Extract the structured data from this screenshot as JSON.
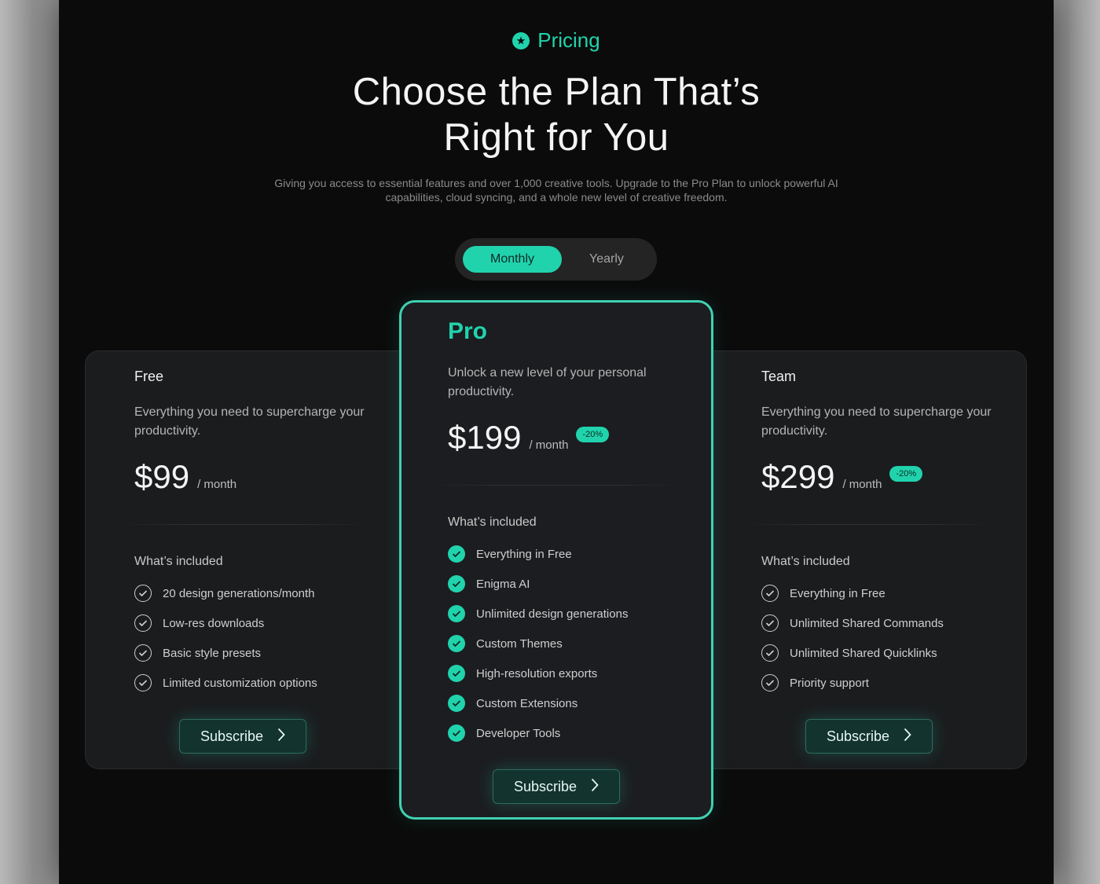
{
  "header": {
    "eyebrow": "Pricing",
    "eyebrow_icon": "star-badge-icon",
    "title_line1": "Choose the Plan That’s",
    "title_line2": "Right for You",
    "subtitle": "Giving you access to essential features and over 1,000 creative tools. Upgrade to the Pro Plan to unlock powerful AI capabilities, cloud syncing, and a whole new level of creative freedom."
  },
  "billing_toggle": {
    "options": [
      "Monthly",
      "Yearly"
    ],
    "selected": "Monthly"
  },
  "colors": {
    "accent": "#20d3ad",
    "background": "#0b0b0b",
    "card": "#1b1c1e"
  },
  "plans": {
    "free": {
      "name": "Free",
      "description": "Everything you need to supercharge your productivity.",
      "price": "$99",
      "period": "/ month",
      "included_heading": "What’s included",
      "features": [
        "20 design generations/month",
        "Low-res downloads",
        "Basic style presets",
        "Limited customization options"
      ],
      "button": "Subscribe"
    },
    "pro": {
      "name": "Pro",
      "description": "Unlock a new level of your personal productivity.",
      "price": "$199",
      "period": "/ month",
      "discount": "-20%",
      "included_heading": "What’s included",
      "features": [
        "Everything in Free",
        "Enigma AI",
        "Unlimited design generations",
        "Custom Themes",
        "High-resolution exports",
        "Custom Extensions",
        "Developer Tools"
      ],
      "button": "Subscribe"
    },
    "team": {
      "name": "Team",
      "description": "Everything you need to supercharge your productivity.",
      "price": "$299",
      "period": "/ month",
      "discount": "-20%",
      "included_heading": "What’s included",
      "features": [
        "Everything in Free",
        "Unlimited Shared Commands",
        "Unlimited Shared Quicklinks",
        "Priority support"
      ],
      "button": "Subscribe"
    }
  }
}
